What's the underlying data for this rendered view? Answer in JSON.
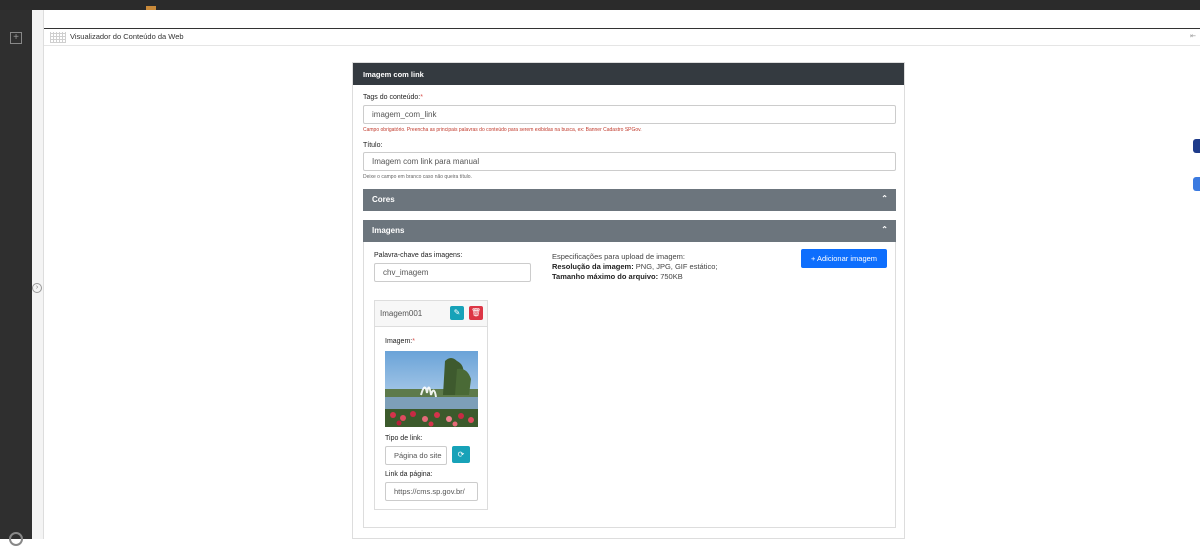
{
  "window": {
    "title": "Visualizador do Conteúdo da Web"
  },
  "card": {
    "title": "Imagem com link"
  },
  "form": {
    "tags": {
      "label": "Tags do conteúdo:",
      "required_mark": "*",
      "value": "imagem_com_link",
      "help": "Campo obrigatório. Preencha as principais palavras do conteúdo para serem exibidas na busca, ex: Banner Cadastro SPGov."
    },
    "title": {
      "label": "Título:",
      "value": "Imagem com link para manual",
      "help": "Deixe o campo em branco caso não queira título."
    }
  },
  "sections": {
    "cores": {
      "label": "Cores",
      "expanded": false
    },
    "imagens": {
      "label": "Imagens",
      "expanded": true
    }
  },
  "imagens": {
    "keyword_label": "Palavra-chave das imagens:",
    "keyword_value": "chv_imagem",
    "spec_title": "Especificações para upload de imagem:",
    "spec_res_label": "Resolução da imagem:",
    "spec_res_value": " PNG, JPG, GIF estático;",
    "spec_size_label": "Tamanho máximo do arquivo:",
    "spec_size_value": " 750KB",
    "add_button": "+ Adicionar imagem",
    "items": [
      {
        "name": "Imagem001",
        "image_label": "Imagem:",
        "required_mark": "*",
        "link_type_label": "Tipo de link:",
        "link_type_value": "Página do site",
        "link_label": "Link da página:",
        "link_value": "https://cms.sp.gov.br/"
      }
    ]
  },
  "colors": {
    "header": "#343a40",
    "section": "#6c757d",
    "primary": "#0d6efd",
    "info": "#17a2b8",
    "danger": "#dc3545"
  },
  "icons": [
    "plus-icon",
    "pencil-icon",
    "trash-icon",
    "refresh-icon",
    "chevron-up-icon",
    "grid-icon"
  ]
}
